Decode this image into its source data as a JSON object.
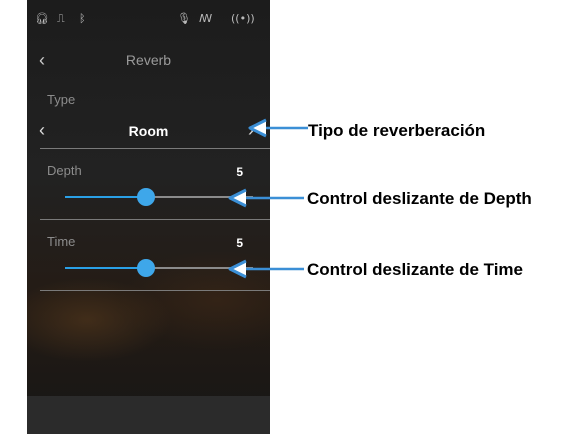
{
  "status_icons": [
    "headphones-icon",
    "usb-icon",
    "bluetooth-icon",
    "microphone-icon",
    "waveform-icon",
    "wireless-icon"
  ],
  "header": {
    "back_icon": "‹",
    "title": "Reverb"
  },
  "type": {
    "label": "Type",
    "value": "Room",
    "prev_icon": "‹",
    "next_icon": "›"
  },
  "depth": {
    "label": "Depth",
    "value": "5",
    "fraction": 0.43
  },
  "time": {
    "label": "Time",
    "value": "5",
    "fraction": 0.43
  },
  "callouts": {
    "type": "Tipo de reverberación",
    "depth": "Control deslizante de Depth",
    "time": "Control deslizante de Time"
  },
  "colors": {
    "accent": "#2aa0e6",
    "callout_arrow": "#3b8fd6"
  }
}
